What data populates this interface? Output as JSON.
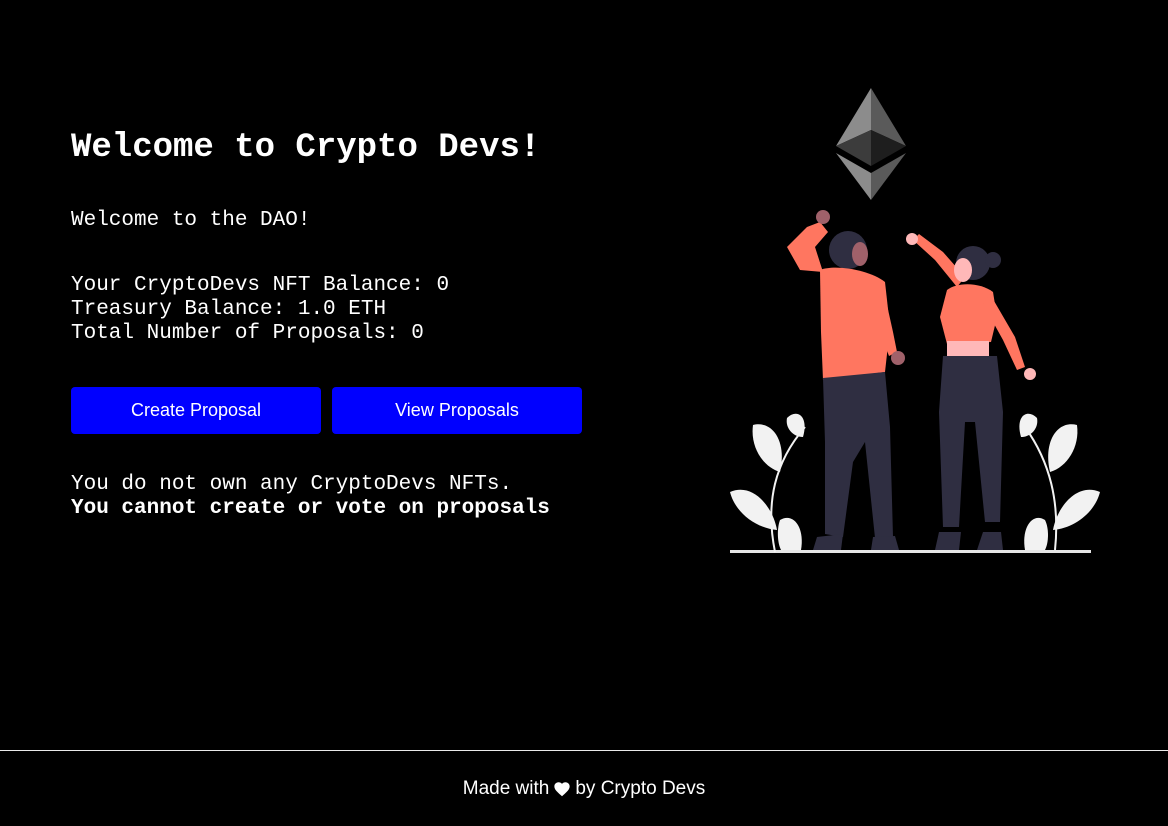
{
  "header": {
    "title": "Welcome to Crypto Devs!",
    "description": "Welcome to the DAO!"
  },
  "stats": {
    "nft_balance": "Your CryptoDevs NFT Balance: 0",
    "treasury_balance": "Treasury Balance: 1.0 ETH",
    "total_proposals": "Total Number of Proposals: 0"
  },
  "actions": {
    "create_label": "Create Proposal",
    "view_label": "View Proposals"
  },
  "notice": {
    "line1": "You do not own any CryptoDevs NFTs.",
    "line2": "You cannot create or vote on proposals"
  },
  "illustration": {
    "icon": "ethereum-logo",
    "scene": "two-people-reaching"
  },
  "footer": {
    "prefix": "Made with",
    "heart_icon": "heart-icon",
    "suffix": "by Crypto Devs"
  },
  "colors": {
    "background": "#000000",
    "button": "#0000ff",
    "accent_shirt": "#ff7660",
    "pants": "#2f2e41"
  }
}
